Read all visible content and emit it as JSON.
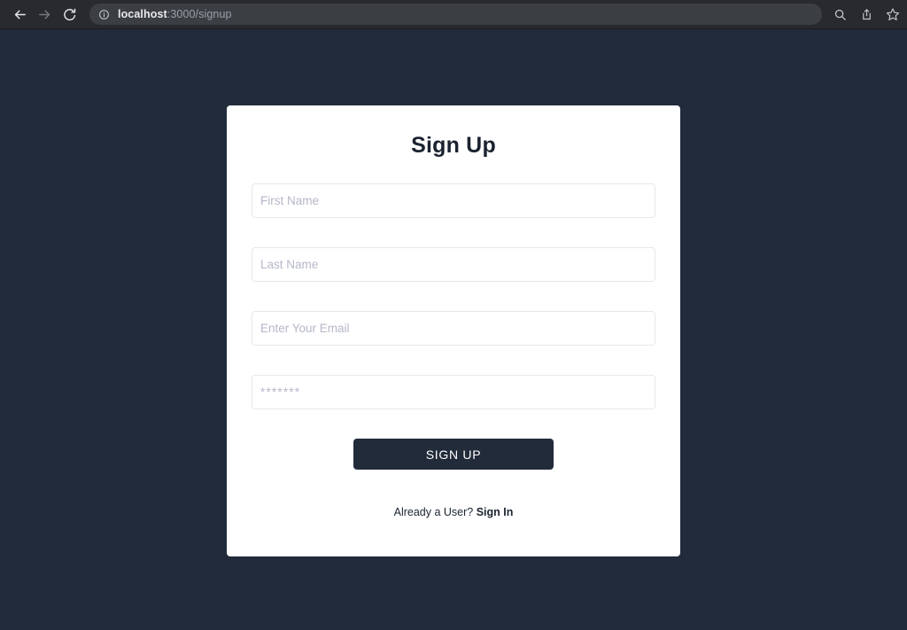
{
  "browser": {
    "back_icon": "back-arrow-icon",
    "forward_icon": "forward-arrow-icon",
    "reload_icon": "reload-icon",
    "site_info_icon": "info-circle-icon",
    "url_host": "localhost",
    "url_path": ":3000/signup",
    "url_full": "localhost:3000/signup",
    "right_icons": [
      {
        "name": "search-icon",
        "label": "Search"
      },
      {
        "name": "share-icon",
        "label": "Share"
      },
      {
        "name": "bookmark-star-icon",
        "label": "Bookmark"
      }
    ]
  },
  "page": {
    "background_color": "#212b3b",
    "card_background": "#ffffff"
  },
  "card": {
    "title": "Sign Up",
    "fields": [
      {
        "name": "first-name-input",
        "placeholder": "First Name",
        "value": "",
        "type": "text"
      },
      {
        "name": "last-name-input",
        "placeholder": "Last Name",
        "value": "",
        "type": "text"
      },
      {
        "name": "email-input",
        "placeholder": "Enter Your Email",
        "value": "",
        "type": "text"
      },
      {
        "name": "password-input",
        "placeholder": "*******",
        "value": "",
        "type": "text"
      }
    ],
    "submit_label": "SIGN UP",
    "submit_color": "#222b3a",
    "footer_text": "Already a User?",
    "footer_link": "Sign In"
  }
}
